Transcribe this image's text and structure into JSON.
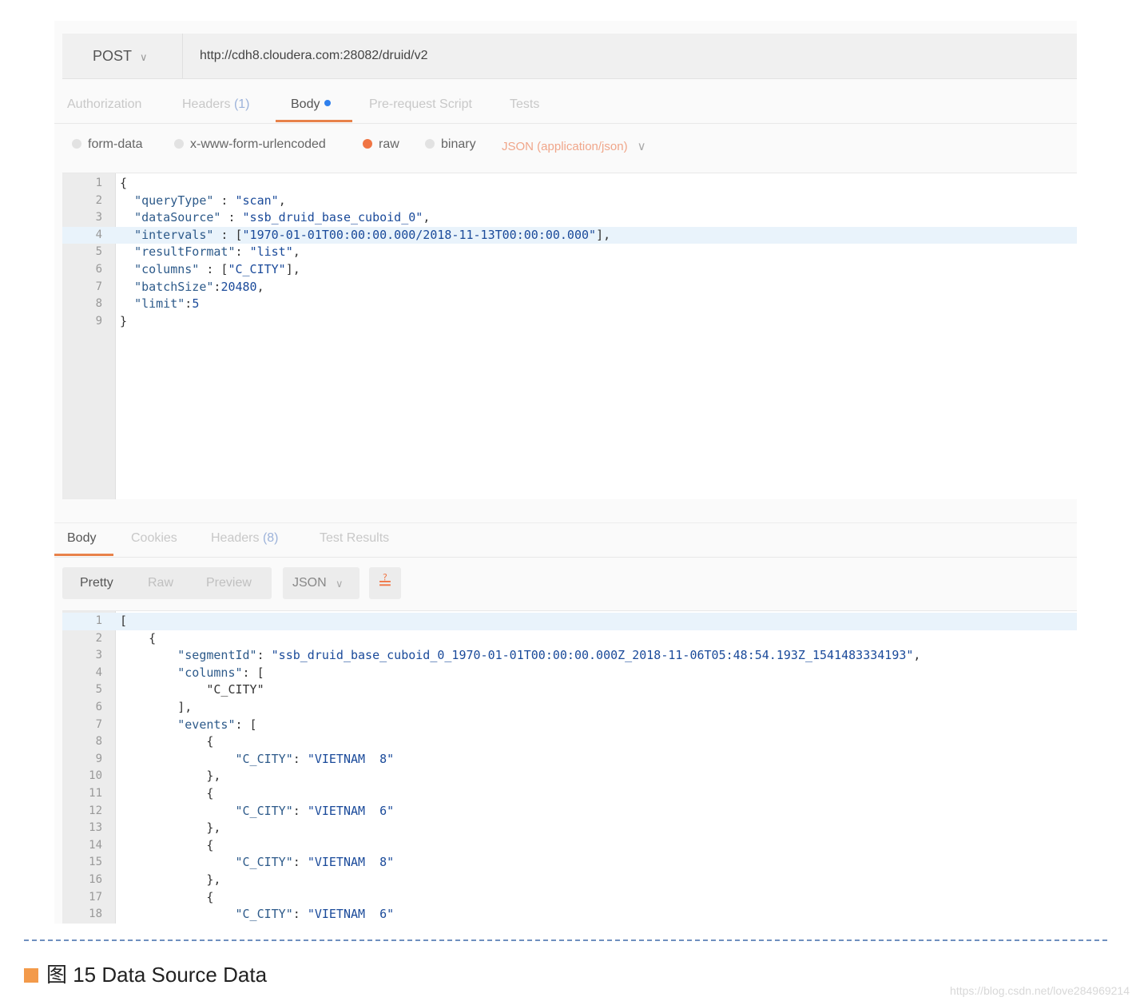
{
  "request": {
    "method": "POST",
    "url": "http://cdh8.cloudera.com:28082/druid/v2",
    "tabs": {
      "authorization": "Authorization",
      "headers": "Headers",
      "headers_count": "(1)",
      "body": "Body",
      "prerequest": "Pre-request Script",
      "tests": "Tests"
    },
    "body_options": {
      "form_data": "form-data",
      "urlencoded": "x-www-form-urlencoded",
      "raw": "raw",
      "binary": "binary",
      "content_type": "JSON (application/json)"
    },
    "lines": [
      {
        "n": "1",
        "text": "{"
      },
      {
        "n": "2",
        "text": "  \"queryType\" : \"scan\","
      },
      {
        "n": "3",
        "text": "  \"dataSource\" : \"ssb_druid_base_cuboid_0\","
      },
      {
        "n": "4",
        "text": "  \"intervals\" : [\"1970-01-01T00:00:00.000/2018-11-13T00:00:00.000\"],"
      },
      {
        "n": "5",
        "text": "  \"resultFormat\": \"list\","
      },
      {
        "n": "6",
        "text": "  \"columns\" : [\"C_CITY\"],"
      },
      {
        "n": "7",
        "text": "  \"batchSize\":20480,"
      },
      {
        "n": "8",
        "text": "  \"limit\":5"
      },
      {
        "n": "9",
        "text": "}"
      }
    ]
  },
  "response": {
    "tabs": {
      "body": "Body",
      "cookies": "Cookies",
      "headers": "Headers",
      "headers_count": "(8)",
      "test_results": "Test Results"
    },
    "view": {
      "pretty": "Pretty",
      "raw": "Raw",
      "preview": "Preview",
      "format": "JSON"
    },
    "lines": [
      {
        "n": "1",
        "text": "["
      },
      {
        "n": "2",
        "text": "    {"
      },
      {
        "n": "3",
        "text": "        \"segmentId\": \"ssb_druid_base_cuboid_0_1970-01-01T00:00:00.000Z_2018-11-06T05:48:54.193Z_1541483334193\","
      },
      {
        "n": "4",
        "text": "        \"columns\": ["
      },
      {
        "n": "5",
        "text": "            \"C_CITY\""
      },
      {
        "n": "6",
        "text": "        ],"
      },
      {
        "n": "7",
        "text": "        \"events\": ["
      },
      {
        "n": "8",
        "text": "            {"
      },
      {
        "n": "9",
        "text": "                \"C_CITY\": \"VIETNAM  8\""
      },
      {
        "n": "10",
        "text": "            },"
      },
      {
        "n": "11",
        "text": "            {"
      },
      {
        "n": "12",
        "text": "                \"C_CITY\": \"VIETNAM  6\""
      },
      {
        "n": "13",
        "text": "            },"
      },
      {
        "n": "14",
        "text": "            {"
      },
      {
        "n": "15",
        "text": "                \"C_CITY\": \"VIETNAM  8\""
      },
      {
        "n": "16",
        "text": "            },"
      },
      {
        "n": "17",
        "text": "            {"
      },
      {
        "n": "18",
        "text": "                \"C_CITY\": \"VIETNAM  6\""
      }
    ]
  },
  "caption": "图 15 Data Source Data",
  "watermark": "https://blog.csdn.net/love284969214"
}
